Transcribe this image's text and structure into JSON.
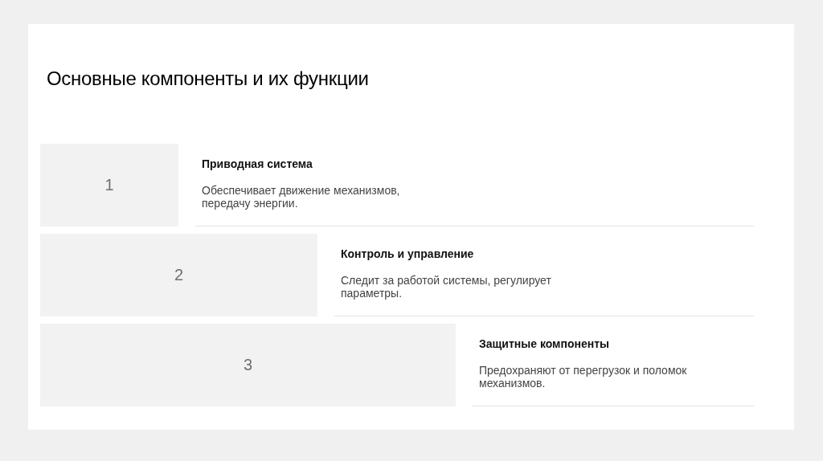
{
  "slide": {
    "title": "Основные компоненты и их функции",
    "steps": [
      {
        "number": "1",
        "heading": "Приводная система",
        "text": "Обеспечивает движение механизмов, передачу энергии."
      },
      {
        "number": "2",
        "heading": "Контроль и управление",
        "text": "Следит за работой системы, регулирует параметры."
      },
      {
        "number": "3",
        "heading": "Защитные компоненты",
        "text": "Предохраняют от перегрузок и поломок механизмов."
      }
    ]
  }
}
